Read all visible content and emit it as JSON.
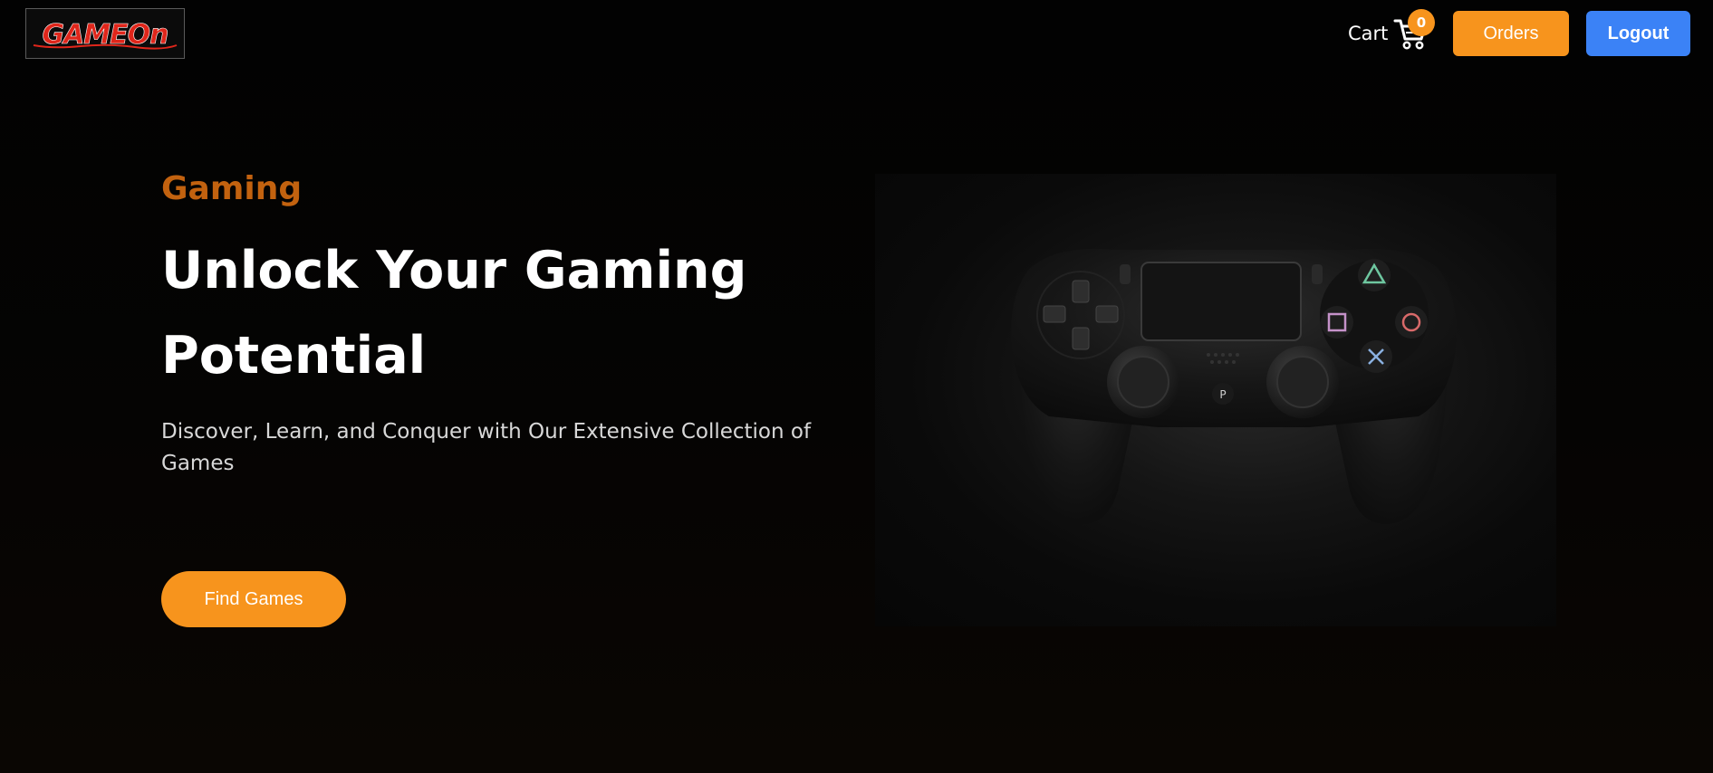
{
  "header": {
    "logo_text": "GAMEOn",
    "cart_label": "Cart",
    "cart_count": "0",
    "orders_label": "Orders",
    "logout_label": "Logout"
  },
  "hero": {
    "eyebrow": "Gaming",
    "title": "Unlock Your Gaming Potential",
    "subtitle": "Discover, Learn, and Conquer with Our Extensive Collection of Games",
    "cta_label": "Find Games",
    "image_subject": "game-controller"
  },
  "colors": {
    "background": "#050403",
    "accent_orange": "#f7941d",
    "eyebrow_orange": "#c2620f",
    "logout_blue": "#3b82f6",
    "text_white": "#ffffff",
    "text_muted": "#d8d8d8",
    "logo_red": "#e0261b"
  },
  "icons": {
    "cart": "shopping-cart-icon"
  }
}
